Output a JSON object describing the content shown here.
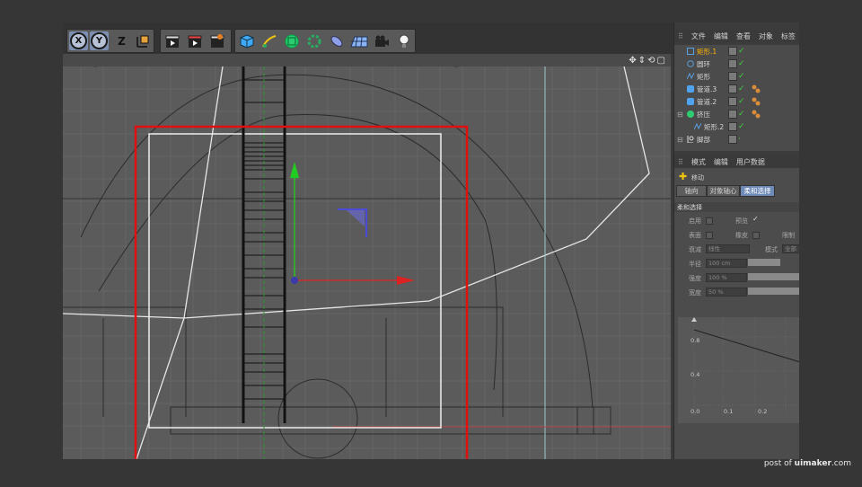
{
  "toolbar": {
    "items": [
      {
        "name": "x-axis-lock",
        "label": "X"
      },
      {
        "name": "y-axis-lock",
        "label": "Y"
      },
      {
        "name": "z-axis-lock",
        "label": "Z"
      },
      {
        "name": "coordinate-system",
        "label": ""
      }
    ]
  },
  "object_manager": {
    "menu": [
      "文件",
      "编辑",
      "查看",
      "对象",
      "标签"
    ],
    "objects": [
      {
        "name": "矩形.1",
        "highlight": true,
        "icon": "rectangle-spline-icon",
        "tag": false
      },
      {
        "name": "圆环",
        "highlight": false,
        "icon": "circle-spline-icon",
        "tag": false
      },
      {
        "name": "矩形",
        "highlight": false,
        "icon": "spline-icon",
        "tag": false
      },
      {
        "name": "管道.3",
        "highlight": false,
        "icon": "tube-icon",
        "tag": true
      },
      {
        "name": "管道.2",
        "highlight": false,
        "icon": "tube-icon",
        "tag": true
      },
      {
        "name": "挤压",
        "highlight": false,
        "icon": "extrude-icon",
        "tag": true
      },
      {
        "name": "矩形.2",
        "highlight": false,
        "icon": "spline-icon",
        "tag": false
      },
      {
        "name": "脚部",
        "highlight": false,
        "icon": "null-icon",
        "tag": false
      }
    ]
  },
  "attributes": {
    "menu": [
      "模式",
      "编辑",
      "用户数据"
    ],
    "tool_name": "移动",
    "tabs": [
      "轴向",
      "对象轴心",
      "柔和选择"
    ],
    "active_tab": "柔和选择",
    "section_title": "柔和选择",
    "labels": {
      "enable": "启用",
      "preview": "预览",
      "surface": "表面",
      "rubber": "橡皮",
      "limit": "限制",
      "falloff": "衰减",
      "mode": "模式",
      "radius": "半径",
      "strength": "强度",
      "width": "宽度"
    },
    "values": {
      "falloff": "线性",
      "mode": "全部",
      "radius": "100 cm",
      "strength": "100 %",
      "width": "50 %"
    },
    "graph": {
      "y_ticks": [
        "0.8",
        "0.4",
        "0.0"
      ],
      "x_ticks": [
        "0.1",
        "0.2"
      ]
    }
  },
  "watermark": {
    "prefix": "post of ",
    "site": "uimaker",
    ".com": ".com"
  },
  "colors": {
    "selection_red": "#e01010",
    "y_axis_green": "#22cc22",
    "x_axis_red": "#dd2222",
    "check_green": "#3fd13f",
    "tab_active": "#6e8bb8"
  }
}
